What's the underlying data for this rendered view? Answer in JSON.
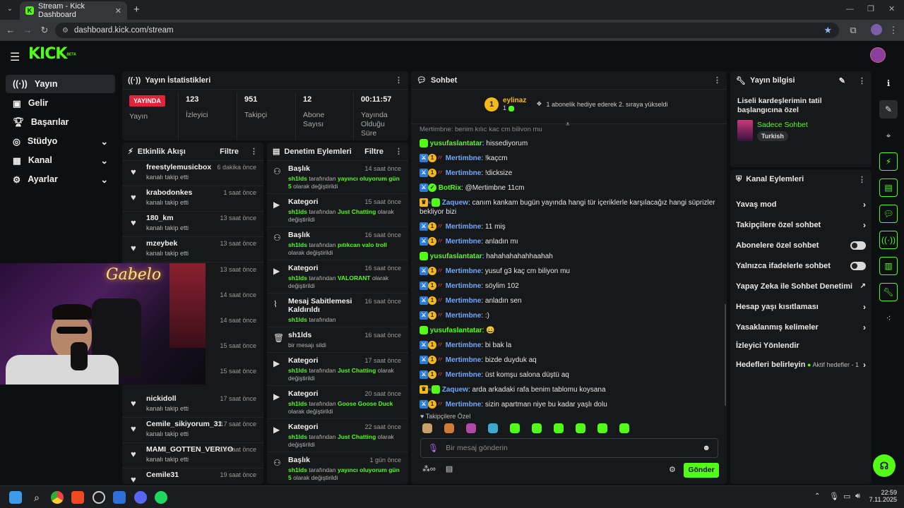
{
  "browser": {
    "tab_title": "Stream - Kick Dashboard",
    "new_tab": "+",
    "url": "dashboard.kick.com/stream"
  },
  "header": {
    "logo": "KICK",
    "logo_beta": "BETA"
  },
  "sidebar": {
    "items": [
      {
        "label": "Yayın",
        "icon": "broadcast-icon"
      },
      {
        "label": "Gelir",
        "icon": "revenue-icon"
      },
      {
        "label": "Başarılar",
        "icon": "trophy-icon"
      },
      {
        "label": "Stüdyo",
        "icon": "studio-icon"
      },
      {
        "label": "Kanal",
        "icon": "channel-icon"
      },
      {
        "label": "Ayarlar",
        "icon": "gear-icon"
      }
    ]
  },
  "stats": {
    "title": "Yayın İstatistikleri",
    "live_badge": "YAYINDA",
    "live_label": "Yayın",
    "viewers_value": "123",
    "viewers_label": "İzleyici",
    "followers_value": "951",
    "followers_label": "Takipçi",
    "subs_value": "12",
    "subs_label": "Abone Sayısı",
    "uptime_value": "00:11:57",
    "uptime_label": "Yayında Olduğu Süre"
  },
  "activity": {
    "title": "Etkinlik Akışı",
    "filter": "Filtre",
    "events": [
      {
        "name": "freestylemusicbox",
        "sub": "kanalı takip etti",
        "time": "6 dakika önce"
      },
      {
        "name": "krabodonkes",
        "sub": "kanalı takip etti",
        "time": "1 saat önce"
      },
      {
        "name": "180_km",
        "sub": "kanalı takip etti",
        "time": "13 saat önce"
      },
      {
        "name": "mzeybek",
        "sub": "kanalı takip etti",
        "time": "13 saat önce"
      }
    ],
    "hidden_times": [
      "13 saat önce",
      "14 saat önce",
      "14 saat önce",
      "15 saat önce",
      "15 saat önce"
    ],
    "events_bottom": [
      {
        "name": "nickidoll",
        "sub": "kanalı takip etti",
        "time": "17 saat önce"
      },
      {
        "name": "Cemile_sikiyorum_31",
        "sub": "kanalı takip etti",
        "time": "17 saat önce"
      },
      {
        "name": "MAMI_GOTTEN_VERIYO",
        "sub": "kanalı takip etti",
        "time": "18 saat önce"
      },
      {
        "name": "Cemile31",
        "sub": "",
        "time": "19 saat önce"
      }
    ]
  },
  "webcam": {
    "neon_sign": "Gabelo"
  },
  "moderation": {
    "title": "Denetim Eylemleri",
    "filter": "Filtre",
    "actions": [
      {
        "title": "Başlık",
        "time": "14 saat önce",
        "user": "sh1lds",
        "pre": "tarafından",
        "value": "yayıncı oluyorum gün 5",
        "post": "olarak değiştirildi",
        "icon": "title-icon"
      },
      {
        "title": "Kategori",
        "time": "15 saat önce",
        "user": "sh1lds",
        "pre": "tarafından",
        "value": "Just Chatting",
        "post": "olarak değiştirildi",
        "icon": "category-icon"
      },
      {
        "title": "Başlık",
        "time": "16 saat önce",
        "user": "sh1lds",
        "pre": "tarafından",
        "value": "pıtıkcan valo troll",
        "post": "olarak değiştirildi",
        "icon": "title-icon"
      },
      {
        "title": "Kategori",
        "time": "16 saat önce",
        "user": "sh1lds",
        "pre": "tarafından",
        "value": "VALORANT",
        "post": "olarak değiştirildi",
        "icon": "category-icon"
      },
      {
        "title": "Mesaj Sabitlemesi Kaldırıldı",
        "time": "16 saat önce",
        "user": "sh1lds",
        "pre": "tarafından",
        "value": "",
        "post": "",
        "icon": "unpin-icon"
      },
      {
        "title": "sh1lds",
        "time": "16 saat önce",
        "user": "",
        "pre": "bir mesajı sildi",
        "value": "",
        "post": "",
        "icon": "trash-icon"
      },
      {
        "title": "Kategori",
        "time": "17 saat önce",
        "user": "sh1lds",
        "pre": "tarafından",
        "value": "Just Chatting",
        "post": "olarak değiştirildi",
        "icon": "category-icon"
      },
      {
        "title": "Kategori",
        "time": "20 saat önce",
        "user": "sh1lds",
        "pre": "tarafından",
        "value": "Goose Goose Duck",
        "post": "olarak değiştirildi",
        "icon": "category-icon"
      },
      {
        "title": "Kategori",
        "time": "22 saat önce",
        "user": "sh1lds",
        "pre": "tarafından",
        "value": "Just Chatting",
        "post": "olarak değiştirildi",
        "icon": "category-icon"
      },
      {
        "title": "Başlık",
        "time": "1 gün önce",
        "user": "sh1lds",
        "pre": "tarafından",
        "value": "yayıncı oluyorum gün 5",
        "post": "olarak değiştirildi",
        "icon": "title-icon"
      }
    ]
  },
  "chat": {
    "title": "Sohbet",
    "pinned_user": "eylinaz",
    "pinned_count": "1",
    "pinned_text": "1 abonelik hediye ederek 2. sıraya yükseldi",
    "top_partial": "Mertimbne: benim kılıç kaç cm biliyon mu",
    "messages": [
      {
        "user": "yusufaslantatar",
        "text": "hissediyorum",
        "color": "#53fc18",
        "badges": "sub"
      },
      {
        "user": "Mertimbne",
        "text": "!kaçcm",
        "color": "#6fa8ff",
        "badges": "mod"
      },
      {
        "user": "Mertimbne",
        "text": "!dicksize",
        "color": "#6fa8ff",
        "badges": "mod"
      },
      {
        "user": "BotRix",
        "text": "@Mertimbne 11cm",
        "color": "#53fc18",
        "badges": "bot"
      },
      {
        "user": "Zaquew",
        "text": "canım kankam bugün yayında hangi tür içeriklerle karşılacağız hangi süprizler bekliyor bizi",
        "color": "#6fa8ff",
        "badges": "vip"
      },
      {
        "user": "Mertimbne",
        "text": "11 miş",
        "color": "#6fa8ff",
        "badges": "mod"
      },
      {
        "user": "Mertimbne",
        "text": "anladın mı",
        "color": "#6fa8ff",
        "badges": "mod"
      },
      {
        "user": "yusufaslantatar",
        "text": "hahahahahahhaahah",
        "color": "#53fc18",
        "badges": "sub"
      },
      {
        "user": "Mertimbne",
        "text": "yusuf g3 kaç cm biliyon mu",
        "color": "#6fa8ff",
        "badges": "mod"
      },
      {
        "user": "Mertimbne",
        "text": "söylim 102",
        "color": "#6fa8ff",
        "badges": "mod"
      },
      {
        "user": "Mertimbne",
        "text": "anladın sen",
        "color": "#6fa8ff",
        "badges": "mod"
      },
      {
        "user": "Mertimbne",
        "text": ":)",
        "color": "#6fa8ff",
        "badges": "mod"
      },
      {
        "user": "yusufaslantatar",
        "text": "😄",
        "color": "#53fc18",
        "badges": "sub"
      },
      {
        "user": "Mertimbne",
        "text": "bi bak la",
        "color": "#6fa8ff",
        "badges": "mod"
      },
      {
        "user": "Mertimbne",
        "text": "bizde duyduk aq",
        "color": "#6fa8ff",
        "badges": "mod"
      },
      {
        "user": "Mertimbne",
        "text": "üst komşu salona düştü aq",
        "color": "#6fa8ff",
        "badges": "mod"
      },
      {
        "user": "Zaquew",
        "text": "arda arkadaki rafa benim tablomu koysana",
        "color": "#6fa8ff",
        "badges": "vip"
      },
      {
        "user": "Mertimbne",
        "text": "sizin apartman niye bu kadar yaşlı dolu",
        "color": "#6fa8ff",
        "badges": "mod"
      }
    ],
    "emote_label": "Takipçilere Özel",
    "input_placeholder": "Bir mesaj gönderin",
    "send": "Gönder"
  },
  "info": {
    "title": "Yayın bilgisi",
    "stream_title": "Liseli kardeşlerimin tatil başlangıcına özel",
    "category": "Sadece Sohbet",
    "language": "Turkish"
  },
  "channel_actions": {
    "title": "Kanal Eylemleri",
    "items": [
      {
        "label": "Yavaş mod",
        "control": "chevron"
      },
      {
        "label": "Takipçilere özel sohbet",
        "control": "chevron"
      },
      {
        "label": "Abonelere özel sohbet",
        "control": "toggle"
      },
      {
        "label": "Yalnızca ifadelerle sohbet",
        "control": "toggle"
      },
      {
        "label": "Yapay Zeka ile Sohbet Denetimi",
        "control": "external"
      },
      {
        "label": "Hesap yaşı kısıtlaması",
        "control": "chevron"
      },
      {
        "label": "Yasaklanmış kelimeler",
        "control": "chevron"
      },
      {
        "label": "İzleyici Yönlendir",
        "control": "none"
      },
      {
        "label": "Hedefleri belirleyin",
        "control": "chevron"
      }
    ],
    "goals_status": "Aktif hedefler - 1"
  },
  "taskbar": {
    "time": "22:59",
    "date": "7.11.2025"
  },
  "colors": {
    "accent": "#53fc18",
    "mod_blue": "#2e7bd6",
    "live_red": "#e0243a"
  }
}
